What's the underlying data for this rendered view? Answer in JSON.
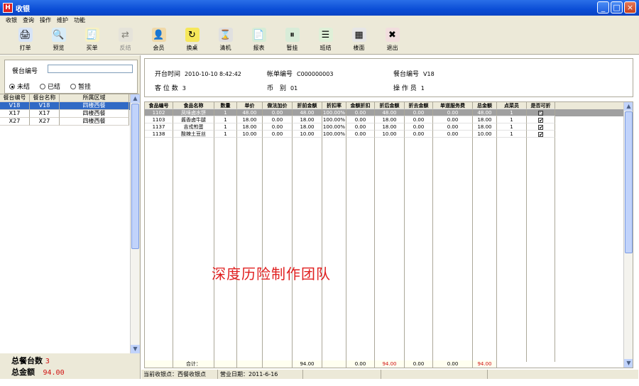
{
  "window": {
    "title": "收银",
    "controls": [
      "_",
      "□",
      "×"
    ]
  },
  "menu": [
    "收银",
    "查询",
    "操作",
    "维护",
    "功能"
  ],
  "toolbar": [
    {
      "label": "打单",
      "icon": "print-icon",
      "glyph": "🖨",
      "color": "#d7e4f7",
      "enabled": true
    },
    {
      "label": "预览",
      "icon": "preview-icon",
      "glyph": "🔍",
      "color": "#d8ecf7",
      "enabled": true
    },
    {
      "label": "买单",
      "icon": "bill-icon",
      "glyph": "🧾",
      "color": "#f7f1c2",
      "enabled": true
    },
    {
      "label": "反结",
      "icon": "reverse-icon",
      "glyph": "⇄",
      "color": "#dddddd",
      "enabled": false
    },
    {
      "label": "会员",
      "icon": "member-icon",
      "glyph": "👤",
      "color": "#f0d9a8",
      "enabled": true
    },
    {
      "label": "换桌",
      "icon": "switch-table-icon",
      "glyph": "↻",
      "color": "#f6e75a",
      "enabled": true
    },
    {
      "label": "清机",
      "icon": "hourglass-icon",
      "glyph": "⌛",
      "color": "#e0e0e0",
      "enabled": true
    },
    {
      "label": "报表",
      "icon": "report-icon",
      "glyph": "📄",
      "color": "#d6ecd6",
      "enabled": true
    },
    {
      "label": "暂挂",
      "icon": "hold-icon",
      "glyph": "⏸",
      "color": "#d8ecd8",
      "enabled": true
    },
    {
      "label": "班结",
      "icon": "shift-close-icon",
      "glyph": "☰",
      "color": "#dff0d8",
      "enabled": true
    },
    {
      "label": "楼面",
      "icon": "floor-icon",
      "glyph": "▦",
      "color": "#e6e6e6",
      "enabled": true
    },
    {
      "label": "退出",
      "icon": "exit-icon",
      "glyph": "✖",
      "color": "#f2dede",
      "enabled": true
    }
  ],
  "left": {
    "table_label": "餐台编号",
    "table_input": "",
    "radios": [
      {
        "label": "未结",
        "checked": true
      },
      {
        "label": "已结",
        "checked": false
      },
      {
        "label": "暂挂",
        "checked": false
      }
    ],
    "columns": [
      "餐台编号",
      "餐台名称",
      "所属区域"
    ],
    "rows": [
      [
        "V18",
        "V18",
        "四楼西餐"
      ],
      [
        "X17",
        "X17",
        "四楼西餐"
      ],
      [
        "X27",
        "X27",
        "四楼西餐"
      ]
    ],
    "summary": {
      "count_label": "总餐台数",
      "count": "3",
      "amount_label": "总金额",
      "amount": "94.00"
    }
  },
  "info": {
    "open_time_label": "开台时间",
    "open_time": "2010-10-10 8:42:42",
    "bill_label": "帐单编号",
    "bill": "C000000003",
    "table_label": "餐台编号",
    "table": "V18",
    "seats_label": "客 位 数",
    "seats": "3",
    "currency_label": "币　别",
    "currency": "01",
    "operator_label": "操 作 员",
    "operator": "1"
  },
  "grid": {
    "columns": [
      "食品编号",
      "食品名称",
      "数量",
      "单价",
      "做法加价",
      "折前金额",
      "折扣率",
      "金额折扣",
      "折后金额",
      "折去金额",
      "单道服务费",
      "总金额",
      "点菜员",
      "是否可折"
    ],
    "rows": [
      [
        "1102",
        "凤味卤水饼",
        "1",
        "48.00",
        "0.00",
        "48.00",
        "100.00%",
        "0.00",
        "48.00",
        "0.00",
        "0.00",
        "48.00",
        "1",
        true
      ],
      [
        "1103",
        "酱香卤牛腿",
        "1",
        "18.00",
        "0.00",
        "18.00",
        "100.00%",
        "0.00",
        "18.00",
        "0.00",
        "0.00",
        "18.00",
        "1",
        true
      ],
      [
        "1137",
        "吉戎煎蛋",
        "1",
        "18.00",
        "0.00",
        "18.00",
        "100.00%",
        "0.00",
        "18.00",
        "0.00",
        "0.00",
        "18.00",
        "1",
        true
      ],
      [
        "1138",
        "酸辣土豆丝",
        "1",
        "10.00",
        "0.00",
        "10.00",
        "100.00%",
        "0.00",
        "10.00",
        "0.00",
        "0.00",
        "10.00",
        "1",
        true
      ]
    ],
    "totals": {
      "label": "合计：",
      "before_discount": "94.00",
      "discount": "0.00",
      "after_discount": "94.00",
      "cut": "0.00",
      "service": "0.00",
      "total": "94.00"
    }
  },
  "watermark": "深度历险制作团队",
  "status": {
    "point": "当前收银点：西餐收银点",
    "date": "营业日期：2011-6-16"
  }
}
